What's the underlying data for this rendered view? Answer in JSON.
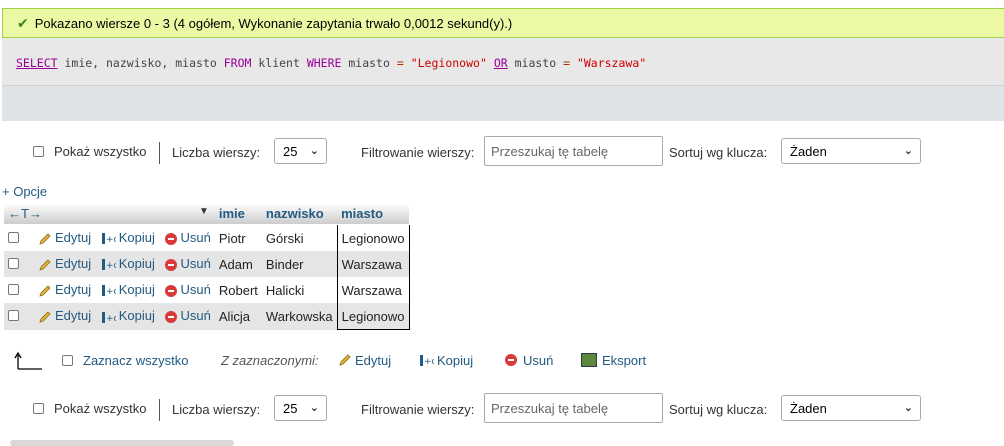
{
  "success_message": "Pokazano wiersze 0 - 3 (4 ogółem, Wykonanie zapytania trwało 0,0012 sekund(y).)",
  "sql": {
    "select": "SELECT",
    "columns": " imie, nazwisko, miasto ",
    "from": "FROM",
    "table": " klient ",
    "where": "WHERE",
    "cond1_col": " miasto ",
    "eq": "=",
    "val1": "\"Legionowo\"",
    "or": "OR",
    "cond2_col": " miasto ",
    "val2": "\"Warszawa\""
  },
  "nav": {
    "show_all": "Pokaż wszystko",
    "rows_label": "Liczba wierszy:",
    "rows_value": "25",
    "filter_label": "Filtrowanie wierszy:",
    "filter_placeholder": "Przeszukaj tę tabelę",
    "sort_label": "Sortuj wg klucza:",
    "sort_value": "Żaden"
  },
  "options_link": "+ Opcje",
  "table": {
    "columns": [
      "imie",
      "nazwisko",
      "miasto"
    ],
    "action_labels": {
      "edit": "Edytuj",
      "copy": "Kopiuj",
      "delete": "Usuń"
    },
    "rows": [
      {
        "imie": "Piotr",
        "nazwisko": "Górski",
        "miasto": "Legionowo"
      },
      {
        "imie": "Adam",
        "nazwisko": "Binder",
        "miasto": "Warszawa"
      },
      {
        "imie": "Robert",
        "nazwisko": "Halicki",
        "miasto": "Warszawa"
      },
      {
        "imie": "Alicja",
        "nazwisko": "Warkowska",
        "miasto": "Legionowo"
      }
    ]
  },
  "bulk": {
    "select_all": "Zaznacz wszystko",
    "with_selected": "Z zaznaczonymi:",
    "edit": "Edytuj",
    "copy": "Kopiuj",
    "delete": "Usuń",
    "export": "Eksport"
  },
  "colors": {
    "success_bg": "#ebf8a4",
    "link": "#235a81",
    "delete": "#d83a3a"
  }
}
